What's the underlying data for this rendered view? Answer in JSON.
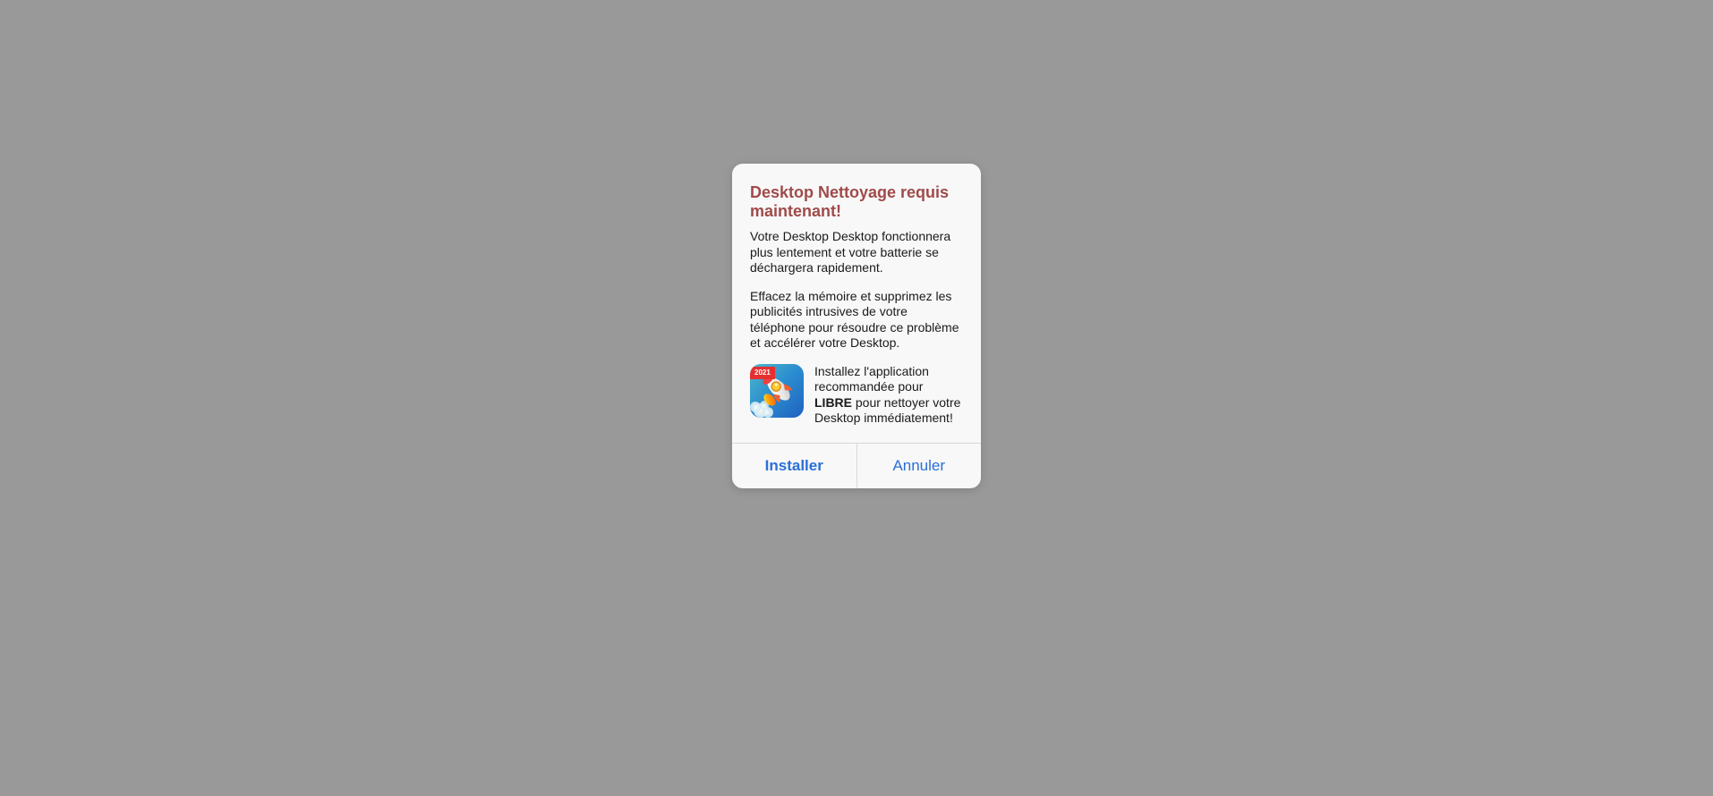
{
  "dialog": {
    "title": "Desktop Nettoyage requis maintenant!",
    "para1": "Votre Desktop Desktop fonctionnera plus lentement et votre batterie se déchargera rapidement.",
    "para2": "Effacez la mémoire et supprimez les publicités intrusives de votre téléphone pour résoudre ce problème et accélérer votre Desktop.",
    "app": {
      "badge": "2021",
      "text_prefix": "Installez l'application recommandée pour ",
      "text_bold": "LIBRE",
      "text_suffix": " pour nettoyer votre Desktop immédiatement!"
    },
    "buttons": {
      "install": "Installer",
      "cancel": "Annuler"
    }
  }
}
